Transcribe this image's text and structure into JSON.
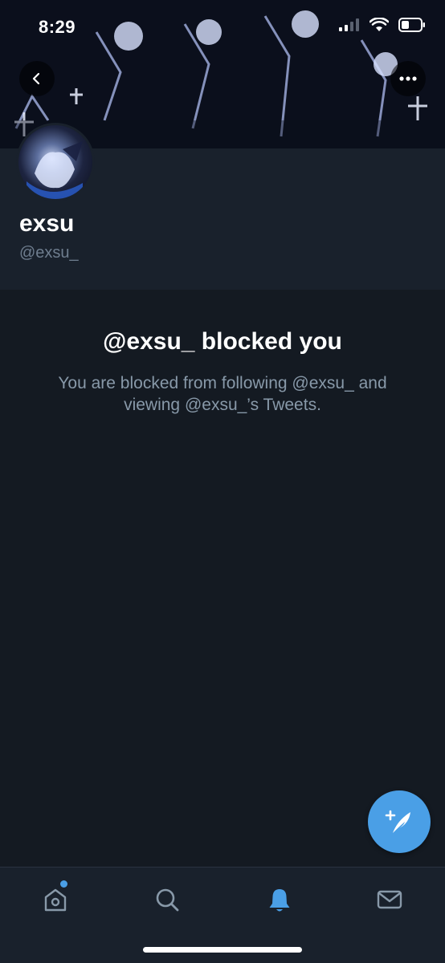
{
  "status_bar": {
    "time": "8:29"
  },
  "profile": {
    "display_name": "exsu",
    "handle": "@exsu_"
  },
  "blocked": {
    "title": "@exsu_ blocked you",
    "description": "You are blocked from following @exsu_ and viewing @exsu_’s Tweets."
  },
  "icons": {
    "back": "chevron-left-icon",
    "more": "more-horizontal-icon",
    "compose": "compose-tweet-icon",
    "home": "home-icon",
    "search": "search-icon",
    "notifications": "bell-icon",
    "messages": "mail-icon"
  },
  "colors": {
    "accent": "#4a9fe6",
    "background": "#141a22",
    "header_background": "#19212c",
    "muted_text": "#8899a9"
  }
}
